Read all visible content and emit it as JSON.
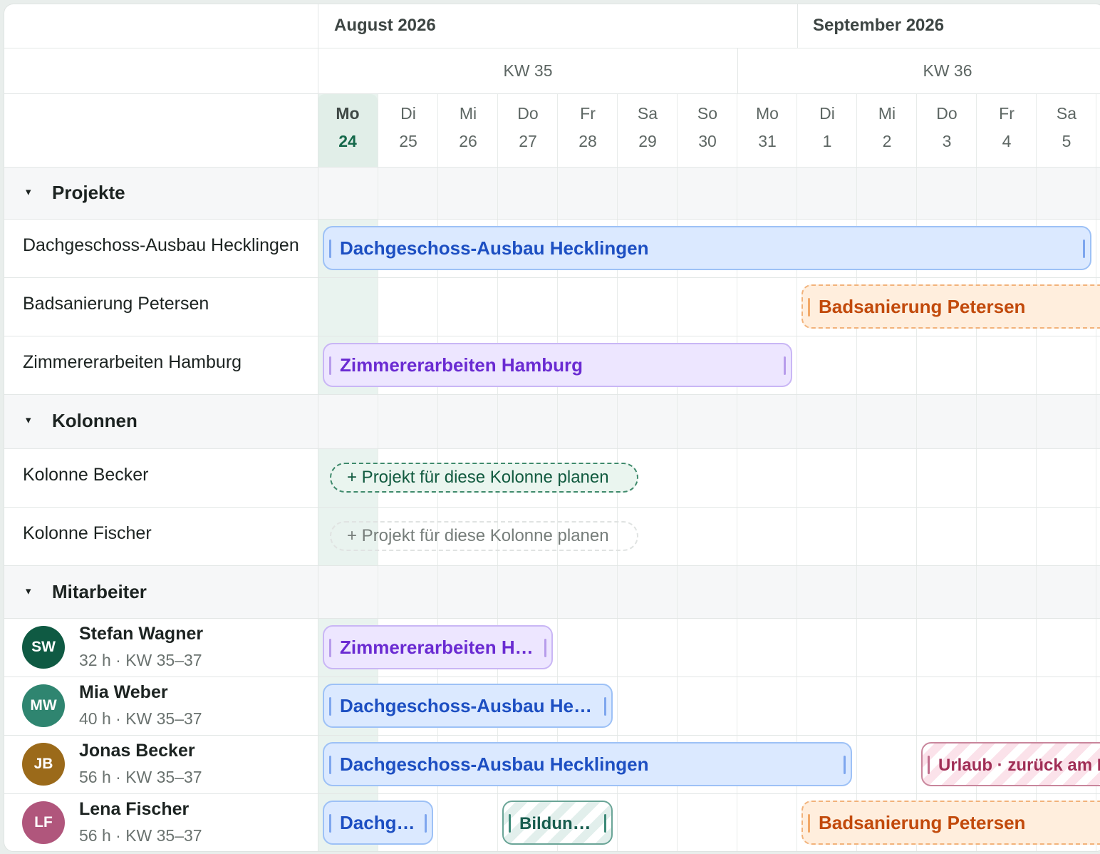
{
  "months": [
    {
      "label": "August 2026"
    },
    {
      "label": "September 2026"
    }
  ],
  "weeks": [
    {
      "label": "KW 35"
    },
    {
      "label": "KW 36"
    }
  ],
  "days": [
    {
      "name": "Mo",
      "date": "24",
      "today": true
    },
    {
      "name": "Di",
      "date": "25"
    },
    {
      "name": "Mi",
      "date": "26"
    },
    {
      "name": "Do",
      "date": "27"
    },
    {
      "name": "Fr",
      "date": "28"
    },
    {
      "name": "Sa",
      "date": "29"
    },
    {
      "name": "So",
      "date": "30"
    },
    {
      "name": "Mo",
      "date": "31"
    },
    {
      "name": "Di",
      "date": "1"
    },
    {
      "name": "Mi",
      "date": "2"
    },
    {
      "name": "Do",
      "date": "3"
    },
    {
      "name": "Fr",
      "date": "4"
    },
    {
      "name": "Sa",
      "date": "5"
    }
  ],
  "groups": {
    "projekte": {
      "title": "Projekte",
      "caret": "▾"
    },
    "kolonnen": {
      "title": "Kolonnen",
      "caret": "▾"
    },
    "mitarbeiter": {
      "title": "Mitarbeiter",
      "caret": "▾"
    }
  },
  "projects": [
    {
      "label": "Dachgeschoss-Ausbau Hecklingen",
      "bar": "Dachgeschoss-Ausbau Hecklingen"
    },
    {
      "label": "Badsanierung Petersen",
      "bar": "Badsanierung Petersen"
    },
    {
      "label": "Zimmererarbeiten Hamburg",
      "bar": "Zimmererarbeiten Hamburg"
    }
  ],
  "crews": [
    {
      "label": "Kolonne Becker",
      "action": "+ Projekt für diese Kolonne planen"
    },
    {
      "label": "Kolonne Fischer",
      "action": "+ Projekt für diese Kolonne planen"
    }
  ],
  "employees": [
    {
      "initials": "SW",
      "name": "Stefan Wagner",
      "sub": "32 h · KW 35–37",
      "color": "#0f5a43",
      "bars": [
        "Zimmererarbeiten Hamburg"
      ]
    },
    {
      "initials": "MW",
      "name": "Mia Weber",
      "sub": "40 h · KW 35–37",
      "color": "#2f8570",
      "bars": [
        "Dachgeschoss-Ausbau Hecklingen"
      ]
    },
    {
      "initials": "JB",
      "name": "Jonas Becker",
      "sub": "56 h · KW 35–37",
      "color": "#9b6a1a",
      "bars": [
        "Dachgeschoss-Ausbau Hecklingen",
        "Urlaub · zurück am Mo"
      ]
    },
    {
      "initials": "LF",
      "name": "Lena Fischer",
      "sub": "56 h · KW 35–37",
      "color": "#b0567c",
      "bars": [
        "Dachgeschoss-Ausbau Hecklingen",
        "Bildungsurlaub",
        "Badsanierung Petersen"
      ]
    }
  ],
  "colors": {
    "today_column": "#e9f3ef",
    "project_blue": "#1d4fc2",
    "project_purple": "#6a2bd2",
    "project_orange": "#c24a0c",
    "training_teal": "#185d4f",
    "vacation_pink": "#a02e56"
  },
  "icons": {
    "caret": "caret-down-icon",
    "drag_handle": "resize-handle-icon"
  }
}
